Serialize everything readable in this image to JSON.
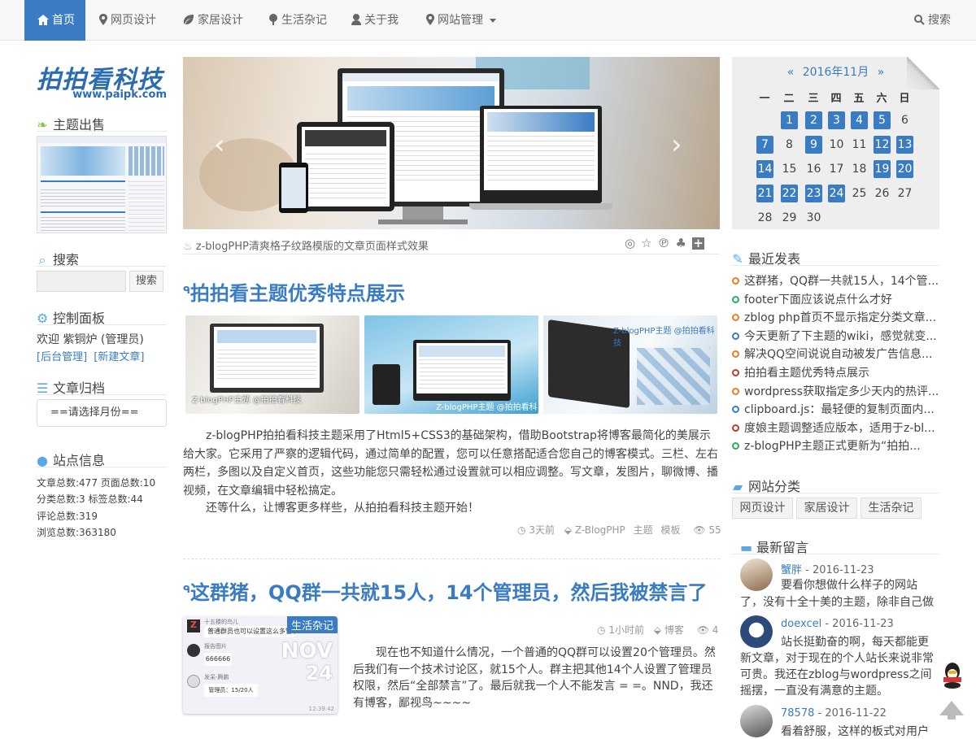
{
  "nav": {
    "items": [
      {
        "label": "首页",
        "icon": "home-icon"
      },
      {
        "label": "网页设计",
        "icon": "map-marker-icon"
      },
      {
        "label": "家居设计",
        "icon": "leaf-icon"
      },
      {
        "label": "生活杂记",
        "icon": "tree-icon"
      },
      {
        "label": "关于我",
        "icon": "user-icon"
      },
      {
        "label": "网站管理",
        "icon": "map-marker-icon"
      }
    ],
    "search_label": "搜索"
  },
  "logo": {
    "text": "拍拍看科技",
    "url": "www.paipk.com"
  },
  "left": {
    "theme_title": "主题出售",
    "search_title": "搜索",
    "search_button": "搜索",
    "search_placeholder": "",
    "panel_title": "控制面板",
    "welcome": "欢迎 紫铜炉 (管理员)",
    "admin_link": "[后台管理]",
    "new_post_link": "[新建文章]",
    "archive_title": "文章归档",
    "archive_select": "==请选择月份==",
    "stats_title": "站点信息",
    "stats": [
      "文章总数:477  页面总数:10",
      "分类总数:3  标签总数:44",
      "评论总数:319",
      "浏览总数:363180"
    ]
  },
  "slider": {
    "caption": "z-blogPHP清爽格子纹路模版的文章页面样式效果"
  },
  "articles": [
    {
      "title": "拍拍看主题优秀特点展示",
      "para1": "z-blogPHP拍拍看科技主题采用了Html5+CSS3的基础架构，借助Bootstrap将博客最简化的美展示给大家。它采用了严察的逻辑代码，通过简单的配置，您可以任意搭配适合您自己的博客模式。三栏、左右两栏，多图以及自定义首页，这些功能您只需轻松通过设置就可以相应调整。写文章，发图片，聊微博、播视频，在文章编辑中轻松搞定。",
      "para2": "还等什么，让博客更多样些，从拍拍看科技主题开始！",
      "time": "3天前",
      "tags": [
        "Z-BlogPHP",
        "主题",
        "模板"
      ],
      "views": "55"
    },
    {
      "title": "这群猪，QQ群一共就15人，14个管理员，然后我被禁言了",
      "category": "生活杂记",
      "date_month": "NOV",
      "date_day": "24",
      "time": "1小时前",
      "tag": "博客",
      "views": "4",
      "para": "现在也不知道什么情况，一个普通的QQ群可以设置20个管理员。然后我们有一个技术讨论区，就15个人。群主把其他14个人设置了管理员权限，然后“全部禁言”了。最后就我一个人不能发言 = =。NND，我还有博客，鄙视鸟~~~~",
      "chat": {
        "group": "十五楼的鸟儿",
        "msg1": "普通群员也可以设置这么多管理员",
        "name2": "报告图片",
        "msg2": "666666",
        "name3": "发呆-腾鹏",
        "msg3": "管理员：15/20人",
        "time": "12:39:42"
      }
    }
  ],
  "calendar": {
    "title": "2016年11月",
    "prev": "«",
    "next": "»",
    "weekdays": [
      "一",
      "二",
      "三",
      "四",
      "五",
      "六",
      "日"
    ],
    "days": [
      "1",
      "2",
      "3",
      "4",
      "5",
      "6",
      "7",
      "8",
      "9",
      "10",
      "11",
      "12",
      "13",
      "14",
      "15",
      "16",
      "17",
      "18",
      "19",
      "20",
      "21",
      "22",
      "23",
      "24",
      "25",
      "26",
      "27",
      "28",
      "29",
      "30"
    ],
    "linked": [
      "1",
      "2",
      "3",
      "4",
      "5",
      "7",
      "9",
      "12",
      "13",
      "14",
      "19",
      "20",
      "21",
      "22",
      "23",
      "24"
    ]
  },
  "recent": {
    "title": "最近发表",
    "items": [
      {
        "text": "这群猪，QQ群一共就15人，14个管...",
        "color": "#e67e22"
      },
      {
        "text": "footer下面应该说点什么才好",
        "color": "#27ae60"
      },
      {
        "text": "zblog php首页不显示指定分类文章...",
        "color": "#e67e22"
      },
      {
        "text": "今天更新了下主题的wiki，感觉就变...",
        "color": "#3a7cc3"
      },
      {
        "text": "解决QQ空间说说自动被发广告信息...",
        "color": "#e67e22"
      },
      {
        "text": "拍拍看主题优秀特点展示",
        "color": "#c0392b"
      },
      {
        "text": "wordpress获取指定多少天内的热评...",
        "color": "#e67e22"
      },
      {
        "text": "clipboard.js：最轻便的复制页面内...",
        "color": "#3a7cc3"
      },
      {
        "text": "度娘主题调整适应版本，适用于z-bl...",
        "color": "#c0392b"
      },
      {
        "text": "z-blogPHP主题正式更新为“拍拍...",
        "color": "#27ae60"
      }
    ]
  },
  "categories": {
    "title": "网站分类",
    "items": [
      "网页设计",
      "家居设计",
      "生活杂记"
    ]
  },
  "comments": {
    "title": "最新留言",
    "items": [
      {
        "name": "蟹胖",
        "date": "- 2016-11-23",
        "text1": "要看你想做什么样子的网站",
        "text2": "了，没有十全十美的主题，除非自己做"
      },
      {
        "name": "doexcel",
        "date": "- 2016-11-23",
        "text1": "站长挺勤奋的啊，每天都能更",
        "text2": "新文章，对于现在的个人站长来说非常",
        "text3": "可贵。我还在zblog与wordpress之间",
        "text4": "摇摆，一直没有满意的主题。"
      },
      {
        "name": "78578",
        "date": "- 2016-11-22",
        "text1": "看着舒服，这样的板式对用户"
      }
    ]
  }
}
